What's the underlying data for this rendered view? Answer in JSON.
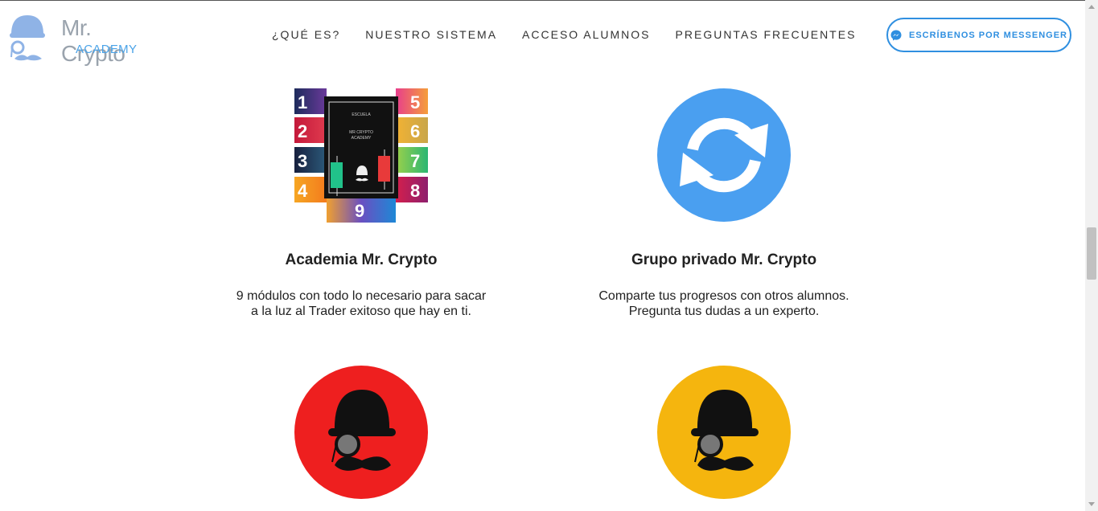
{
  "brand": {
    "name": "Mr. Crypto",
    "sub": "ACADEMY",
    "colors": {
      "blue": "#4aa3e8",
      "grey": "#9aa3ad"
    }
  },
  "nav": {
    "items": [
      {
        "label": "¿QUÉ ES?"
      },
      {
        "label": "NUESTRO SISTEMA"
      },
      {
        "label": "ACCESO ALUMNOS"
      },
      {
        "label": "PREGUNTAS FRECUENTES"
      }
    ]
  },
  "cta": {
    "label": "ESCRÍBENOS POR MESSENGER",
    "icon": "messenger-icon",
    "color": "#2f8fe0"
  },
  "features": [
    {
      "title": "Academia Mr. Crypto",
      "desc_line1": "9 módulos con todo lo necesario para sacar",
      "desc_line2": "a la luz al Trader exitoso que hay en ti.",
      "image": "modules-collage",
      "modules": [
        "1",
        "2",
        "3",
        "4",
        "5",
        "6",
        "7",
        "8",
        "9"
      ],
      "book_text": [
        "ESCUELA",
        "MR CRYPTO",
        "ACADEMY"
      ]
    },
    {
      "title": "Grupo privado Mr. Crypto",
      "desc_line1": "Comparte tus progresos con otros alumnos.",
      "desc_line2": "Pregunta tus dudas a un experto.",
      "image": "sync-icon",
      "color": "#4a9ff0"
    }
  ],
  "mascots": [
    {
      "name": "mascot-red",
      "color": "#ee1f1f"
    },
    {
      "name": "mascot-yellow",
      "color": "#f5b50e"
    }
  ]
}
